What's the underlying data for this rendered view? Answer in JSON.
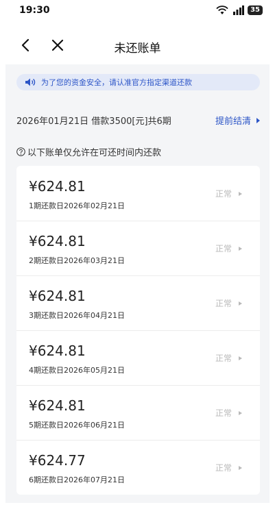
{
  "status_bar": {
    "time": "19:30",
    "battery": "35"
  },
  "nav": {
    "title": "未还账单"
  },
  "notice": {
    "text": "为了您的资金安全，请认准官方指定渠道还款"
  },
  "loan": {
    "info": "2026年01月21日 借款3500[元]共6期",
    "early_settle": "提前结清"
  },
  "hint": {
    "text": "以下账单仅允许在可还时间内还款"
  },
  "bills": [
    {
      "amount": "¥624.81",
      "due": "1期还款日2026年02月21日",
      "status": "正常"
    },
    {
      "amount": "¥624.81",
      "due": "2期还款日2026年03月21日",
      "status": "正常"
    },
    {
      "amount": "¥624.81",
      "due": "3期还款日2026年04月21日",
      "status": "正常"
    },
    {
      "amount": "¥624.81",
      "due": "4期还款日2026年05月21日",
      "status": "正常"
    },
    {
      "amount": "¥624.81",
      "due": "5期还款日2026年06月21日",
      "status": "正常"
    },
    {
      "amount": "¥624.77",
      "due": "6期还款日2026年07月21日",
      "status": "正常"
    }
  ],
  "colors": {
    "accent": "#2c55c7",
    "background": "#f4f5f7",
    "status_text": "#b9b9b9"
  }
}
